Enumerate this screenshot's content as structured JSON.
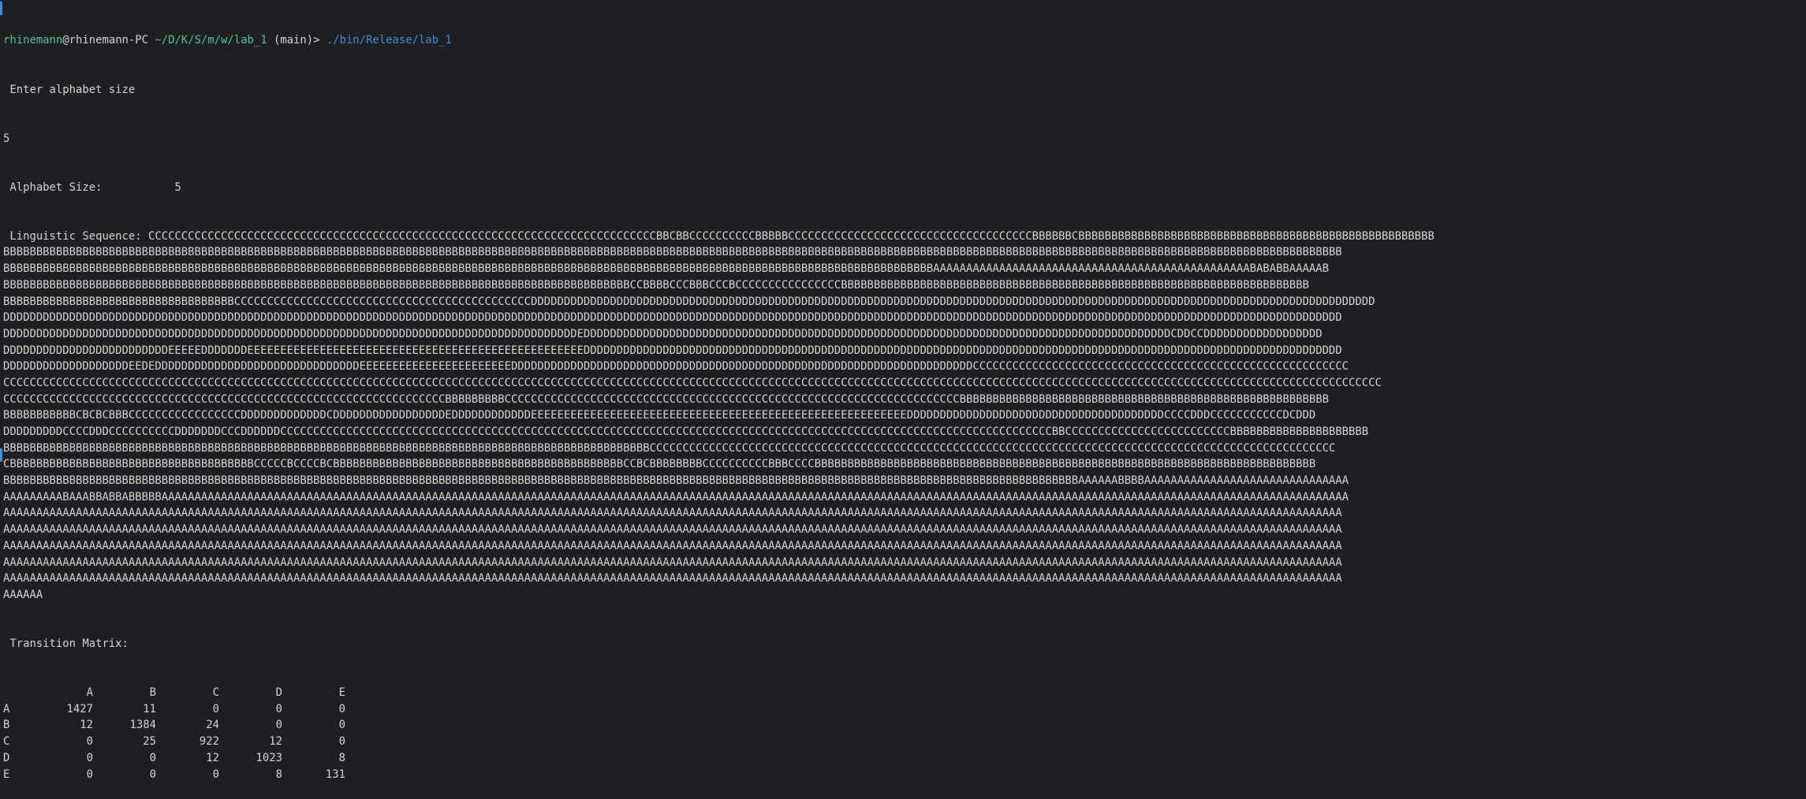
{
  "prompt": {
    "user": "rhinemann",
    "at": "@",
    "host": "rhinemann-PC",
    "path": "~/D/K/S/m/w/lab_1",
    "branch": "(main)>",
    "command": "./bin/Release/lab_1"
  },
  "output": {
    "enter_prompt": " Enter alphabet size",
    "input_value": "5",
    "alphabet_size_label": " Alphabet Size:",
    "alphabet_size_value": "5",
    "sequence_label": " Linguistic Sequence: ",
    "sequence_lines": [
      "CCCCCCCCCCCCCCCCCCCCCCCCCCCCCCCCCCCCCCCCCCCCCCCCCCCCCCCCCCCCCCCCCCCCCCCCCCCCCBBCBBCCCCCCCCCCBBBBBCCCCCCCCCCCCCCCCCCCCCCCCCCCCCCCCCCCCCBBBBBBCBBBBBBBBBBBBBBBBBBBBBBBBBBBBBBBBBBBBBBBBBBBBBBBBBBBBBB",
      "BBBBBBBBBBBBBBBBBBBBBBBBBBBBBBBBBBBBBBBBBBBBBBBBBBBBBBBBBBBBBBBBBBBBBBBBBBBBBBBBBBBBBBBBBBBBBBBBBBBBBBBBBBBBBBBBBBBBBBBBBBBBBBBBBBBBBBBBBBBBBBBBBBBBBBBBBBBBBBBBBBBBBBBBBBBBBBBBBBBBBBBBBBBBBBBBBBBBBBBBBBB",
      "BBBBBBBBBBBBBBBBBBBBBBBBBBBBBBBBBBBBBBBBBBBBBBBBBBBBBBBBBBBBBBBBBBBBBBBBBBBBBBBBBBBBBBBBBBBBBBBBBBBBBBBBBBBBBBBBBBBBBBBBBBBBBBBBBBBBBBBBBBBBBAAAAAAAAAAAAAAAAAAAAAAAAAAAAAAAAAAAAAAAAAAAAAAAABABABBAAAAAB",
      "BBBBBBBBBBBBBBBBBBBBBBBBBBBBBBBBBBBBBBBBBBBBBBBBBBBBBBBBBBBBBBBBBBBBBBBBBBBBBBBBBBBBBBBBBBBBBBBCCBBBBCCCBBBCCCBCCCCCCCCCCCCCCCCBBBBBBBBBBBBBBBBBBBBBBBBBBBBBBBBBBBBBBBBBBBBBBBBBBBBBBBBBBBBBBBBBBBBBBB",
      "BBBBBBBBBBBBBBBBBBBBBBBBBBBBBBBBBBBCCCCCCCCCCCCCCCCCCCCCCCCCCCCCCCCCCCCCCCCCCCCCDDDDDDDDDDDDDDDDDDDDDDDDDDDDDDDDDDDDDDDDDDDDDDDDDDDDDDDDDDDDDDDDDDDDDDDDDDDDDDDDDDDDDDDDDDDDDDDDDDDDDDDDDDDDDDDDDDDDDDDDDDDDDDDD",
      "DDDDDDDDDDDDDDDDDDDDDDDDDDDDDDDDDDDDDDDDDDDDDDDDDDDDDDDDDDDDDDDDDDDDDDDDDDDDDDDDDDDDDDDDDDDDDDDDDDDDDDDDDDDDDDDDDDDDDDDDDDDDDDDDDDDDDDDDDDDDDDDDDDDDDDDDDDDDDDDDDDDDDDDDDDDDDDDDDDDDDDDDDDDDDDDDDDDDDDDDDDD",
      "DDDDDDDDDDDDDDDDDDDDDDDDDDDDDDDDDDDDDDDDDDDDDDDDDDDDDDDDDDDDDDDDDDDDDDDDDDDDDDDDDDDDDDDEDDDDDDDDDDDDDDDDDDDDDDDDDDDDDDDDDDDDDDDDDDDDDDDDDDDDDDDDDDDDDDDDDDDDDDDDDDDDDDDDDDDDDDDDDCDDCCDDDDDDDDDDDDDDDDDD",
      "DDDDDDDDDDDDDDDDDDDDDDDDDEEEEEDDDDDDDEEEEEEEEEEEEEEEEEEEEEEEEEEEEEEEEEEEEEEEEEEEEEEEEEEEDDDDDDDDDDDDDDDDDDDDDDDDDDDDDDDDDDDDDDDDDDDDDDDDDDDDDDDDDDDDDDDDDDDDDDDDDDDDDDDDDDDDDDDDDDDDDDDDDDDDDDDDDDDDDDDDDDD",
      "DDDDDDDDDDDDDDDDDDDEEDEDDDDDDDDDDDDDDDDDDDDDDDDDDDDDDDEEEEEEEEEEEEEEEEEEEEEEEDDDDDDDDDDDDDDDDDDDDDDDDDDDDDDDDDDDDDDDDDDDDDDDDDDDDDDDDDDDDDDDDDDDDDDCCCCCCCCCCCCCCCCCCCCCCCCCCCCCCCCCCCCCCCCCCCCCCCCCCCCCCCCC",
      "CCCCCCCCCCCCCCCCCCCCCCCCCCCCCCCCCCCCCCCCCCCCCCCCCCCCCCCCCCCCCCCCCCCCCCCCCCCCCCCCCCCCCCCCCCCCCCCCCCCCCCCCCCCCCCCCCCCCCCCCCCCCCCCCCCCCCCCCCCCCCCCCCCCCCCCCCCCCCCCCCCCCCCCCCCCCCCCCCCCCCCCCCCCCCCCCCCCCCCCCCCCCCCCCC",
      "CCCCCCCCCCCCCCCCCCCCCCCCCCCCCCCCCCCCCCCCCCCCCCCCCCCCCCCCCCCCCCCCCCCBBBBBBBBBCCCCCCCCCCCCCCCCCCCCCCCCCCCCCCCCCCCCCCCCCCCCCCCCCCCCCCCCCCCCCCCCCCCCCBBBBBBBBBBBBBBBBBBBBBBBBBBBBBBBBBBBBBBBBBBBBBBBBBBBBBBBB",
      "BBBBBBBBBBBCBCBCBBBCCCCCCCCCCCCCCCCCDDDDDDDDDDDDDCDDDDDDDDDDDDDDDDDEDDDDDDDDDDDDEEEEEEEEEEEEEEEEEEEEEEEEEEEEEEEEEEEEEEEEEEEEEEEEEEEEEEEEEDDDDDDDDDDDDDDDDDDDDDDDDDDDDDDDDDDDDDDDCCCCDDDCCCCCCCCCCCDCDDD",
      "DDDDDDDDDCCCCDDDCCCCCCCCCCDDDDDDDCCCDDDDDDCCCCCCCCCCCCCCCCCCCCCCCCCCCCCCCCCCCCCCCCCCCCCCCCCCCCCCCCCCCCCCCCCCCCCCCCCCCCCCCCCCCCCCCCCCCCCCCCCCCCCCCCCCCCCCCCCCCCCBBCCCCCCCCCCCCCCCCCCCCCCCCCBBBBBBBBBBBBBBBBBBBBB",
      "BBBBBBBBBBBBBBBBBBBBBBBBBBBBBBBBBBBBBBBBBBBBBBBBBBBBBBBBBBBBBBBBBBBBBBBBBBBBBBBBBBBBBBBBBBBBBBBBBBCCCCCCCCCCCCCCCCCCCCCCCCCCCCCCCCCCCCCCCCCCCCCCCCCCCCCCCCCCCCCCCCCCCCCCCCCCCCCCCCCCCCCCCCCCCCCCCCCCCCCCCC",
      "CBBBBBBBBBBBBBBBBBBBBBBBBBBBBBBBBBBBBBCCCCCBCCCCBCBBBBBBBBBBBBBBBBBBBBBBBBBBBBBBBBBBBBBBBBBBBBCCBCBBBBBBBBCCCCCCCCCCBBBCCCCBBBBBBBBBBBBBBBBBBBBBBBBBBBBBBBBBBBBBBBBBBBBBBBBBBBBBBBBBBBBBBBBBBBBBBBBBBBB",
      "BBBBBBBBBBBBBBBBBBBBBBBBBBBBBBBBBBBBBBBBBBBBBBBBBBBBBBBBBBBBBBBBBBBBBBBBBBBBBBBBBBBBBBBBBBBBBBBBBBBBBBBBBBBBBBBBBBBBBBBBBBBBBBBBBBBBBBBBBBBBBBBBBBBBBBBBBBBBBBBBBBBAAAAAABBBBAAAAAAAAAAAAAAAAAAAAAAAAAAAAAAA",
      "AAAAAAAAABAAABBABBABBBBBAAAAAAAAAAAAAAAAAAAAAAAAAAAAAAAAAAAAAAAAAAAAAAAAAAAAAAAAAAAAAAAAAAAAAAAAAAAAAAAAAAAAAAAAAAAAAAAAAAAAAAAAAAAAAAAAAAAAAAAAAAAAAAAAAAAAAAAAAAAAAAAAAAAAAAAAAAAAAAAAAAAAAAAAAAAAAAAAAAAA",
      "AAAAAAAAAAAAAAAAAAAAAAAAAAAAAAAAAAAAAAAAAAAAAAAAAAAAAAAAAAAAAAAAAAAAAAAAAAAAAAAAAAAAAAAAAAAAAAAAAAAAAAAAAAAAAAAAAAAAAAAAAAAAAAAAAAAAAAAAAAAAAAAAAAAAAAAAAAAAAAAAAAAAAAAAAAAAAAAAAAAAAAAAAAAAAAAAAAAAAAAAAAA",
      "AAAAAAAAAAAAAAAAAAAAAAAAAAAAAAAAAAAAAAAAAAAAAAAAAAAAAAAAAAAAAAAAAAAAAAAAAAAAAAAAAAAAAAAAAAAAAAAAAAAAAAAAAAAAAAAAAAAAAAAAAAAAAAAAAAAAAAAAAAAAAAAAAAAAAAAAAAAAAAAAAAAAAAAAAAAAAAAAAAAAAAAAAAAAAAAAAAAAAAAAAAA",
      "AAAAAAAAAAAAAAAAAAAAAAAAAAAAAAAAAAAAAAAAAAAAAAAAAAAAAAAAAAAAAAAAAAAAAAAAAAAAAAAAAAAAAAAAAAAAAAAAAAAAAAAAAAAAAAAAAAAAAAAAAAAAAAAAAAAAAAAAAAAAAAAAAAAAAAAAAAAAAAAAAAAAAAAAAAAAAAAAAAAAAAAAAAAAAAAAAAAAAAAAAAA",
      "AAAAAAAAAAAAAAAAAAAAAAAAAAAAAAAAAAAAAAAAAAAAAAAAAAAAAAAAAAAAAAAAAAAAAAAAAAAAAAAAAAAAAAAAAAAAAAAAAAAAAAAAAAAAAAAAAAAAAAAAAAAAAAAAAAAAAAAAAAAAAAAAAAAAAAAAAAAAAAAAAAAAAAAAAAAAAAAAAAAAAAAAAAAAAAAAAAAAAAAAAAA",
      "AAAAAAAAAAAAAAAAAAAAAAAAAAAAAAAAAAAAAAAAAAAAAAAAAAAAAAAAAAAAAAAAAAAAAAAAAAAAAAAAAAAAAAAAAAAAAAAAAAAAAAAAAAAAAAAAAAAAAAAAAAAAAAAAAAAAAAAAAAAAAAAAAAAAAAAAAAAAAAAAAAAAAAAAAAAAAAAAAAAAAAAAAAAAAAAAAAAAAAAAAAA",
      "AAAAAA"
    ],
    "matrix_label": " Transition Matrix:",
    "matrix": {
      "columns": [
        "A",
        "B",
        "C",
        "D",
        "E"
      ],
      "rows": [
        {
          "label": "A",
          "values": [
            "1427",
            "11",
            "0",
            "0",
            "0"
          ]
        },
        {
          "label": "B",
          "values": [
            "12",
            "1384",
            "24",
            "0",
            "0"
          ]
        },
        {
          "label": "C",
          "values": [
            "0",
            "25",
            "922",
            "12",
            "0"
          ]
        },
        {
          "label": "D",
          "values": [
            "0",
            "0",
            "12",
            "1023",
            "8"
          ]
        },
        {
          "label": "E",
          "values": [
            "0",
            "0",
            "0",
            "8",
            "131"
          ]
        }
      ]
    }
  },
  "colors": {
    "background": "#1e1f22",
    "text": "#d4d4d4",
    "prompt_green": "#4ec48f",
    "command_blue": "#3b8fd6"
  }
}
